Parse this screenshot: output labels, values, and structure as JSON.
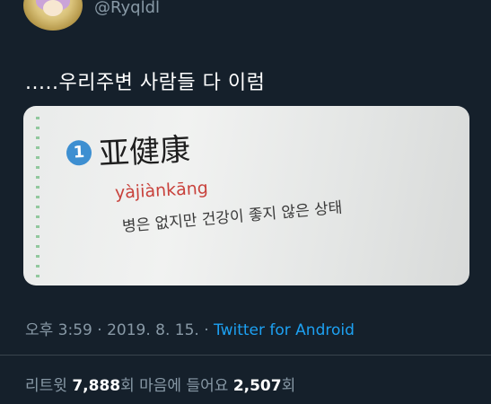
{
  "user": {
    "handle": "@Ryqldl"
  },
  "tweet": {
    "text": ".....우리주변 사람들 다 이럼"
  },
  "photo": {
    "number": "1",
    "hanzi": "亚健康",
    "pinyin": "yàjiànkāng",
    "meaning": "병은 없지만 건강이 좋지 않은 상태"
  },
  "meta": {
    "time_date": "오후 3:59 · 2019. 8. 15. · ",
    "source": "Twitter for Android"
  },
  "stats": {
    "retweet_label": "리트윗 ",
    "retweet_count": "7,888",
    "retweet_unit": "회  ",
    "like_label": "마음에 들어요 ",
    "like_count": "2,507",
    "like_unit": "회"
  },
  "colors": {
    "background": "#15202b",
    "link": "#1da1f2",
    "muted": "#8899a6"
  },
  "icons": [
    "avatar-image"
  ]
}
